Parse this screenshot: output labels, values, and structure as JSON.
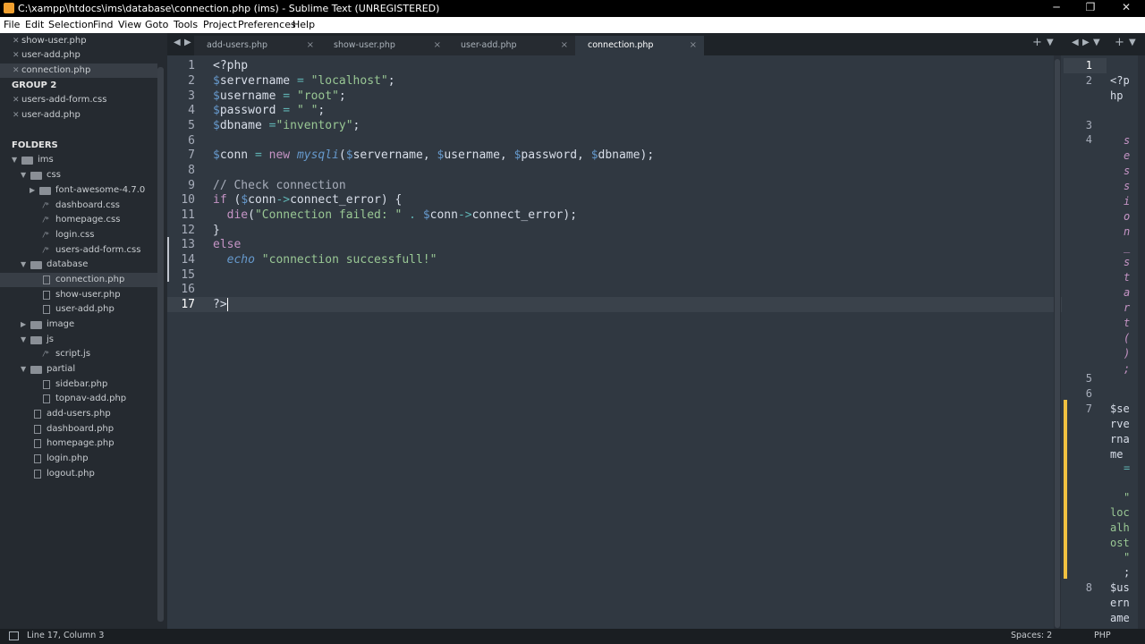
{
  "window": {
    "title": "C:\\xampp\\htdocs\\ims\\database\\connection.php (ims) - Sublime Text (UNREGISTERED)",
    "minimize": "─",
    "maximize": "❐",
    "close": "✕"
  },
  "menu": [
    "File",
    "Edit",
    "Selection",
    "Find",
    "View",
    "Goto",
    "Tools",
    "Project",
    "Preferences",
    "Help"
  ],
  "sidebar": {
    "open_files_group1": [
      "show-user.php",
      "user-add.php",
      "connection.php"
    ],
    "group2_label": "GROUP 2",
    "open_files_group2": [
      "users-add-form.css",
      "user-add.php"
    ],
    "folders_label": "FOLDERS",
    "tree": {
      "root": "ims",
      "css": "css",
      "font_awesome": "font-awesome-4.7.0",
      "css_files": [
        "dashboard.css",
        "homepage.css",
        "login.css",
        "users-add-form.css"
      ],
      "database": "database",
      "database_files": [
        "connection.php",
        "show-user.php",
        "user-add.php"
      ],
      "image": "image",
      "js": "js",
      "js_files": [
        "script.js"
      ],
      "partial": "partial",
      "partial_files": [
        "sidebar.php",
        "topnav-add.php"
      ],
      "root_files": [
        "add-users.php",
        "dashboard.php",
        "homepage.php",
        "login.php",
        "logout.php"
      ]
    }
  },
  "tabs": [
    {
      "label": "add-users.php"
    },
    {
      "label": "show-user.php"
    },
    {
      "label": "user-add.php"
    },
    {
      "label": "connection.php"
    }
  ],
  "tab_close": "×",
  "editor": {
    "line_numbers": [
      "1",
      "2",
      "3",
      "4",
      "5",
      "6",
      "7",
      "8",
      "9",
      "10",
      "11",
      "12",
      "13",
      "14",
      "15",
      "16",
      "17"
    ],
    "current_line": "17"
  },
  "pane2": {
    "line_numbers": [
      "1",
      "2",
      "3",
      "4",
      "5",
      "6",
      "7",
      "8"
    ],
    "fragments": {
      "php_open": "<?p\nhp",
      "session_start": "s\ne\ns\ns\ni\no\nn\n_\ns\nt\na\nr\nt\n(\n)\n;",
      "servername": "$se\nrve\nrna\nme",
      "equals": "=",
      "quote1": "\"",
      "localhost": "loc\nalh\nost",
      "quote2": "\"",
      "semicolon": ";",
      "username": "$us\nern\name"
    }
  },
  "status": {
    "position": "Line 17, Column 3",
    "spaces": "Spaces: 2",
    "syntax": "PHP"
  },
  "colors": {
    "editor_bg": "#303841",
    "sidebar_bg": "#252a30",
    "keyword": "#c594c5",
    "string": "#99c794",
    "variable": "#6699cc",
    "comment": "#a7adba"
  }
}
